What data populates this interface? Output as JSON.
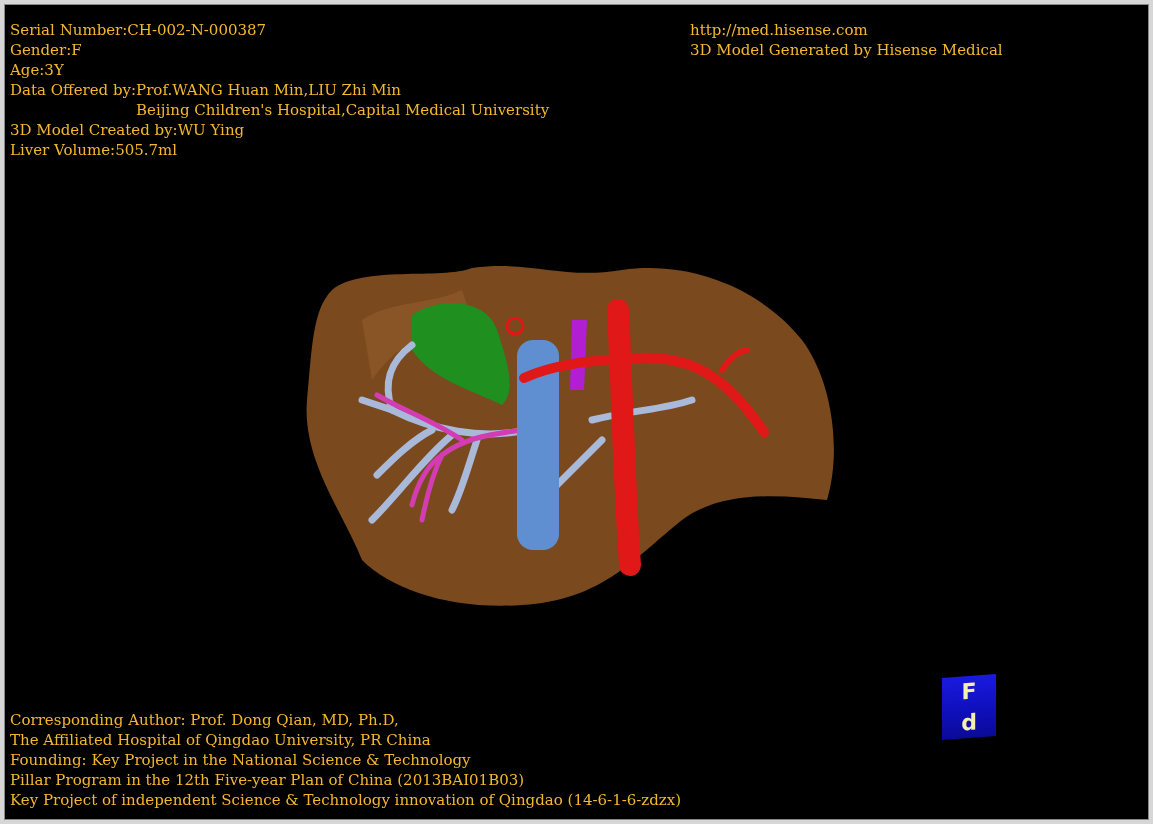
{
  "patient": {
    "serial_number": "Serial Number:CH-002-N-000387",
    "gender": "Gender:F",
    "age": "Age:3Y",
    "data_offered": {
      "label": "Data Offered by:",
      "lines": [
        "Prof.WANG Huan Min,LIU Zhi Min",
        "Beijing Children's Hospital,Capital Medical University"
      ]
    },
    "created_by": "3D Model Created by:WU Ying",
    "liver_volume": "Liver Volume:505.7ml"
  },
  "branding": {
    "url": "http://med.hisense.com",
    "credit": "3D Model Generated by Hisense Medical"
  },
  "orientation_cube": {
    "faces": [
      "F",
      "d"
    ]
  },
  "footer": [
    "Corresponding Author: Prof. Dong Qian, MD, Ph.D,",
    "The Affiliated Hospital of Qingdao University, PR China",
    "Founding: Key Project in the National Science & Technology",
    "Pillar Program in the 12th Five-year Plan of China (2013BAI01B03)",
    "Key Project of independent Science & Technology innovation of Qingdao (14-6-1-6-zdzx)"
  ]
}
